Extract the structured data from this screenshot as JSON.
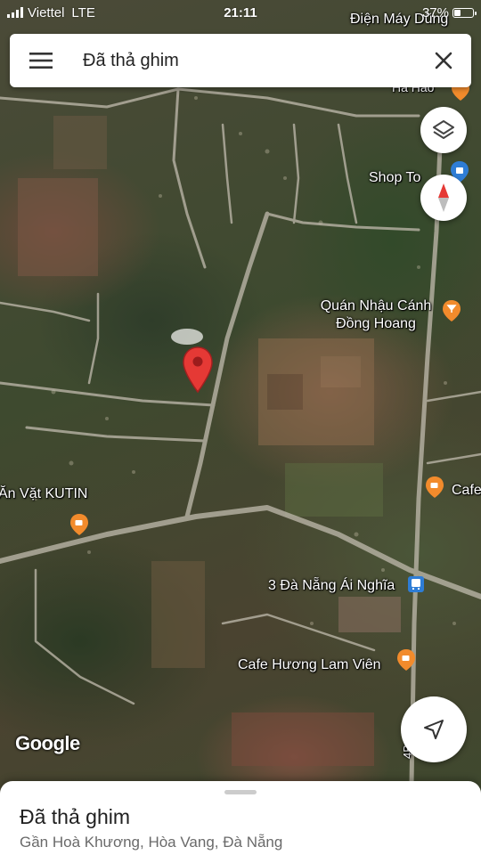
{
  "status_bar": {
    "carrier": "Viettel",
    "network": "LTE",
    "time": "21:11",
    "battery_percent": "37%",
    "battery_level": 0.37
  },
  "search": {
    "query": "Đã thả ghim",
    "menu_icon": "hamburger-menu-icon",
    "close_icon": "close-icon"
  },
  "map": {
    "labels": {
      "dien_may_dung": "Điện Máy Dũng",
      "ha_hao": "Hà Hảo",
      "shop_to": "Shop To",
      "quan_nhau_line1": "Quán Nhậu Cánh",
      "quan_nhau_line2": "Đồng Hoang",
      "an_vat": "Ăn Vặt KUTIN",
      "cafe_right": "Cafe",
      "bus_stop": "3 Đà Nẵng Ái Nghĩa",
      "cafe_huong": "Cafe Hương Lam Viên",
      "road_4b": "4B"
    },
    "google_logo": "Google",
    "colors": {
      "pin": "#e53935",
      "poi_orange": "#f28b2c",
      "poi_blue": "#2e7dd6"
    }
  },
  "controls": {
    "layers_icon": "layers-icon",
    "compass_icon": "compass-icon",
    "my_location_icon": "navigation-arrow-icon"
  },
  "bottom_sheet": {
    "title": "Đã thả ghim",
    "subtitle": "Gần Hoà Khương, Hòa Vang, Đà Nẵng"
  }
}
